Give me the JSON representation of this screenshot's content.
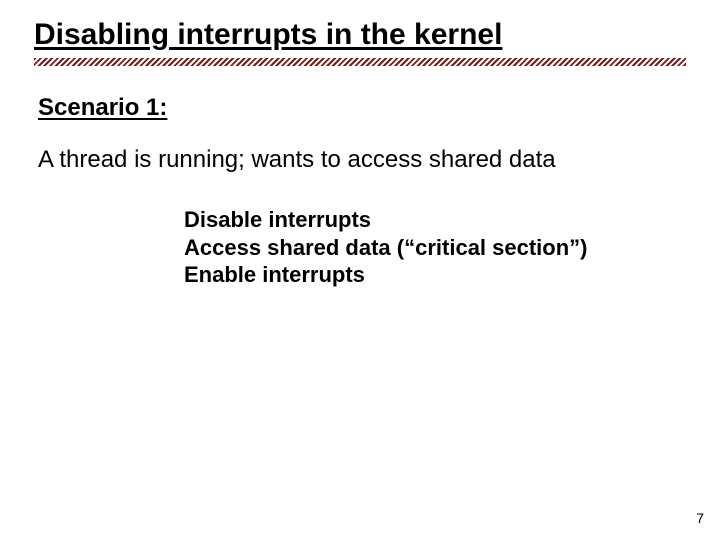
{
  "title": "Disabling interrupts in the kernel",
  "scenario_label": "Scenario 1:",
  "lead": "A thread is running; wants to access shared data",
  "steps": {
    "s1": "Disable interrupts",
    "s2": "Access shared data (“critical section”)",
    "s3": "Enable interrupts"
  },
  "page_number": "7"
}
